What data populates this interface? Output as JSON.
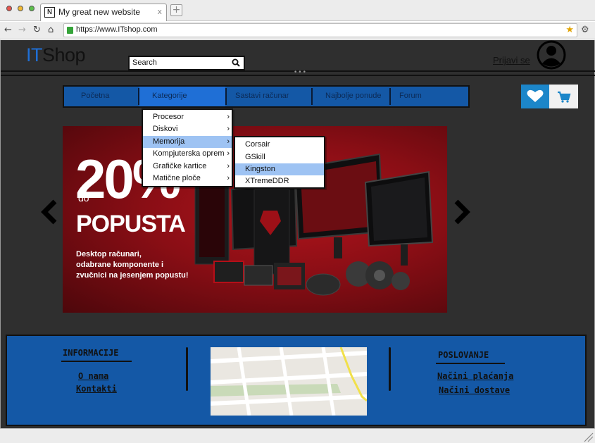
{
  "browser": {
    "tab_title": "My great new website",
    "tab_icon": "N",
    "tab_close": "x",
    "new_tab": "+",
    "url": "https://www.ITshop.com"
  },
  "header": {
    "logo_it": "IT",
    "logo_shop": "Shop",
    "search_placeholder": "Search",
    "login_label": "Prijavi se"
  },
  "nav": {
    "items": [
      {
        "label": "Početna"
      },
      {
        "label": "Kategorije"
      },
      {
        "label": "Sastavi računar"
      },
      {
        "label": "Najbolje ponude"
      },
      {
        "label": "Forum"
      }
    ],
    "active_index": 1
  },
  "categories_menu": [
    {
      "label": "Procesor",
      "arrow": "›"
    },
    {
      "label": "Diskovi",
      "arrow": "›"
    },
    {
      "label": "Memorija",
      "arrow": "›"
    },
    {
      "label": "Kompjuterska oprem",
      "arrow": "›"
    },
    {
      "label": "Grafičke kartice",
      "arrow": "›"
    },
    {
      "label": "Matične ploče",
      "arrow": "›"
    }
  ],
  "memory_submenu": [
    {
      "label": "Corsair"
    },
    {
      "label": "GSkill"
    },
    {
      "label": "Kingston"
    },
    {
      "label": "XTremeDDR"
    }
  ],
  "banner": {
    "big": "20%",
    "do": "do",
    "popusta": "POPUSTA",
    "desc_lines": [
      "Desktop računari,",
      "odabrane komponente i",
      "zvučnici na jesenjem popustu!"
    ]
  },
  "footer": {
    "info_title": "INFORMACIJE",
    "info_links": [
      "O nama",
      "Kontakti"
    ],
    "business_title": "POSLOVANJE",
    "business_links": [
      "Načini plaćanja",
      "Načini dostave"
    ]
  },
  "colors": {
    "brand_blue": "#1f6fd6",
    "nav_blue": "#1458a6",
    "highlight": "#9ec3f3",
    "banner_red": "#b0141c"
  }
}
